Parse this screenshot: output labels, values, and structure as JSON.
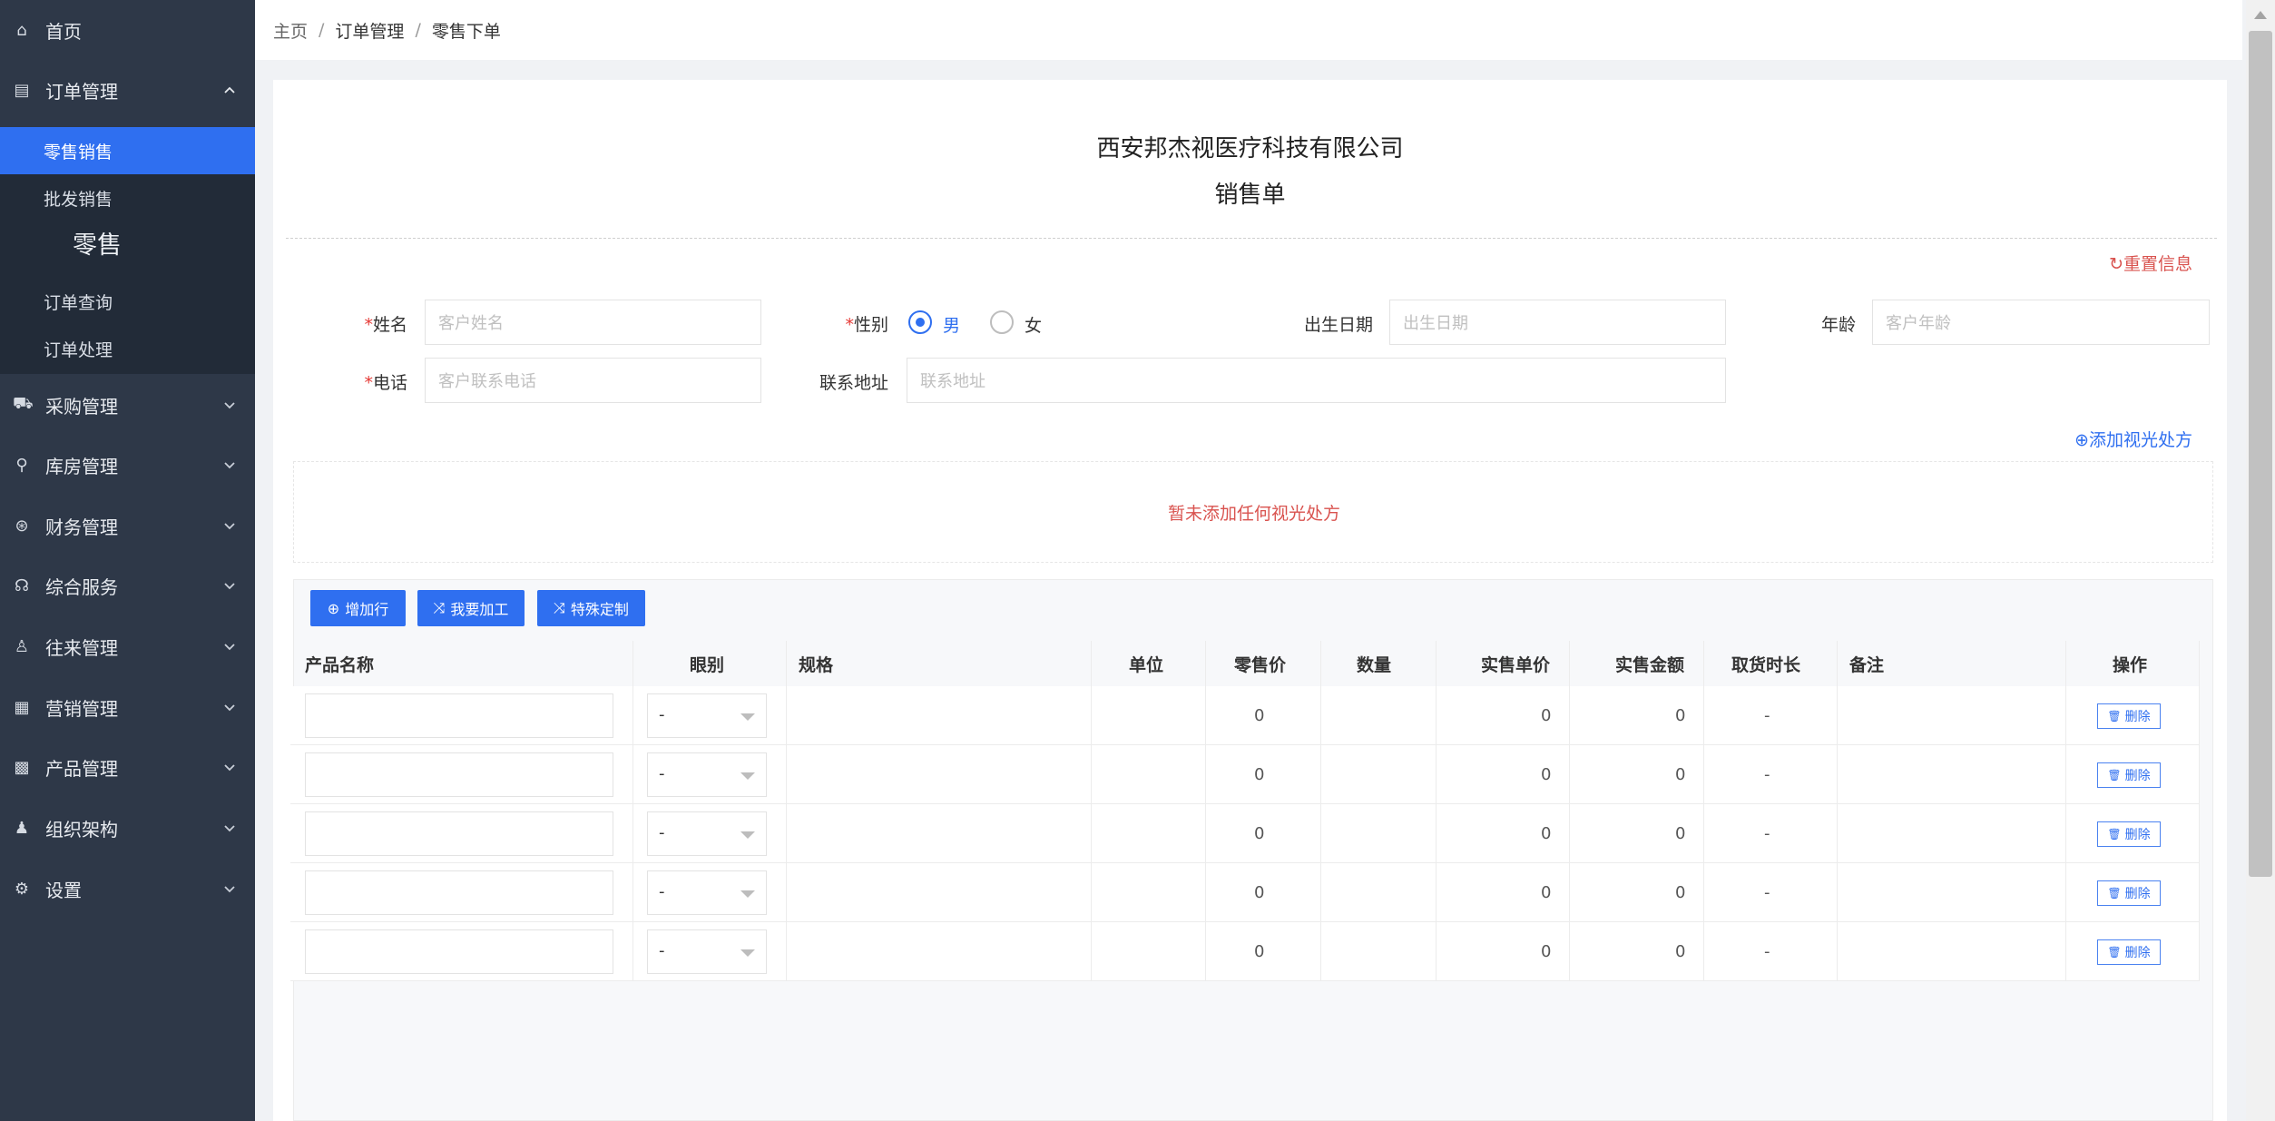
{
  "sidebar": {
    "items": [
      {
        "icon": "home-icon",
        "glyph": "⌂",
        "label": "首页"
      },
      {
        "icon": "order-icon",
        "glyph": "▤",
        "label": "订单管理"
      },
      {
        "icon": "cart-icon",
        "glyph": "⛟",
        "label": "采购管理"
      },
      {
        "icon": "warehouse-icon",
        "glyph": "⚲",
        "label": "库房管理"
      },
      {
        "icon": "finance-icon",
        "glyph": "⊛",
        "label": "财务管理"
      },
      {
        "icon": "service-icon",
        "glyph": "☊",
        "label": "综合服务"
      },
      {
        "icon": "contacts-icon",
        "glyph": "♙",
        "label": "往来管理"
      },
      {
        "icon": "marketing-icon",
        "glyph": "▦",
        "label": "营销管理"
      },
      {
        "icon": "product-icon",
        "glyph": "▩",
        "label": "产品管理"
      },
      {
        "icon": "org-icon",
        "glyph": "♟",
        "label": "组织架构"
      },
      {
        "icon": "settings-icon",
        "glyph": "⚙",
        "label": "设置"
      }
    ],
    "submenu": [
      "零售销售",
      "批发销售",
      "订单查询",
      "订单处理"
    ],
    "tooltip": "零售"
  },
  "breadcrumb": [
    "主页",
    "订单管理",
    "零售下单"
  ],
  "header": {
    "company": "西安邦杰视医疗科技有限公司",
    "title": "销售单"
  },
  "actions": {
    "reset": "重置信息",
    "add_rx": "添加视光处方"
  },
  "form": {
    "name": {
      "label": "姓名",
      "placeholder": "客户姓名"
    },
    "gender": {
      "label": "性别",
      "male": "男",
      "female": "女",
      "selected": "男"
    },
    "birth": {
      "label": "出生日期",
      "placeholder": "出生日期"
    },
    "age": {
      "label": "年龄",
      "placeholder": "客户年龄"
    },
    "phone": {
      "label": "电话",
      "placeholder": "客户联系电话"
    },
    "address": {
      "label": "联系地址",
      "placeholder": "联系地址"
    }
  },
  "rx_empty": "暂未添加任何视光处方",
  "toolbar": {
    "add_row": "增加行",
    "process": "我要加工",
    "custom": "特殊定制"
  },
  "table": {
    "columns": [
      "产品名称",
      "眼别",
      "规格",
      "单位",
      "零售价",
      "数量",
      "实售单价",
      "实售金额",
      "取货时长",
      "备注",
      "操作"
    ],
    "rows": [
      {
        "eye": "-",
        "retail": "0",
        "actual_price": "0",
        "amount": "0",
        "pickup": "-",
        "delete": "删除"
      },
      {
        "eye": "-",
        "retail": "0",
        "actual_price": "0",
        "amount": "0",
        "pickup": "-",
        "delete": "删除"
      },
      {
        "eye": "-",
        "retail": "0",
        "actual_price": "0",
        "amount": "0",
        "pickup": "-",
        "delete": "删除"
      },
      {
        "eye": "-",
        "retail": "0",
        "actual_price": "0",
        "amount": "0",
        "pickup": "-",
        "delete": "删除"
      },
      {
        "eye": "-",
        "retail": "0",
        "actual_price": "0",
        "amount": "0",
        "pickup": "-",
        "delete": "删除"
      }
    ]
  },
  "colors": {
    "sidebar": "#2e3848",
    "submenu": "#222b38",
    "accent": "#2f6ff0",
    "danger": "#d9534f"
  }
}
